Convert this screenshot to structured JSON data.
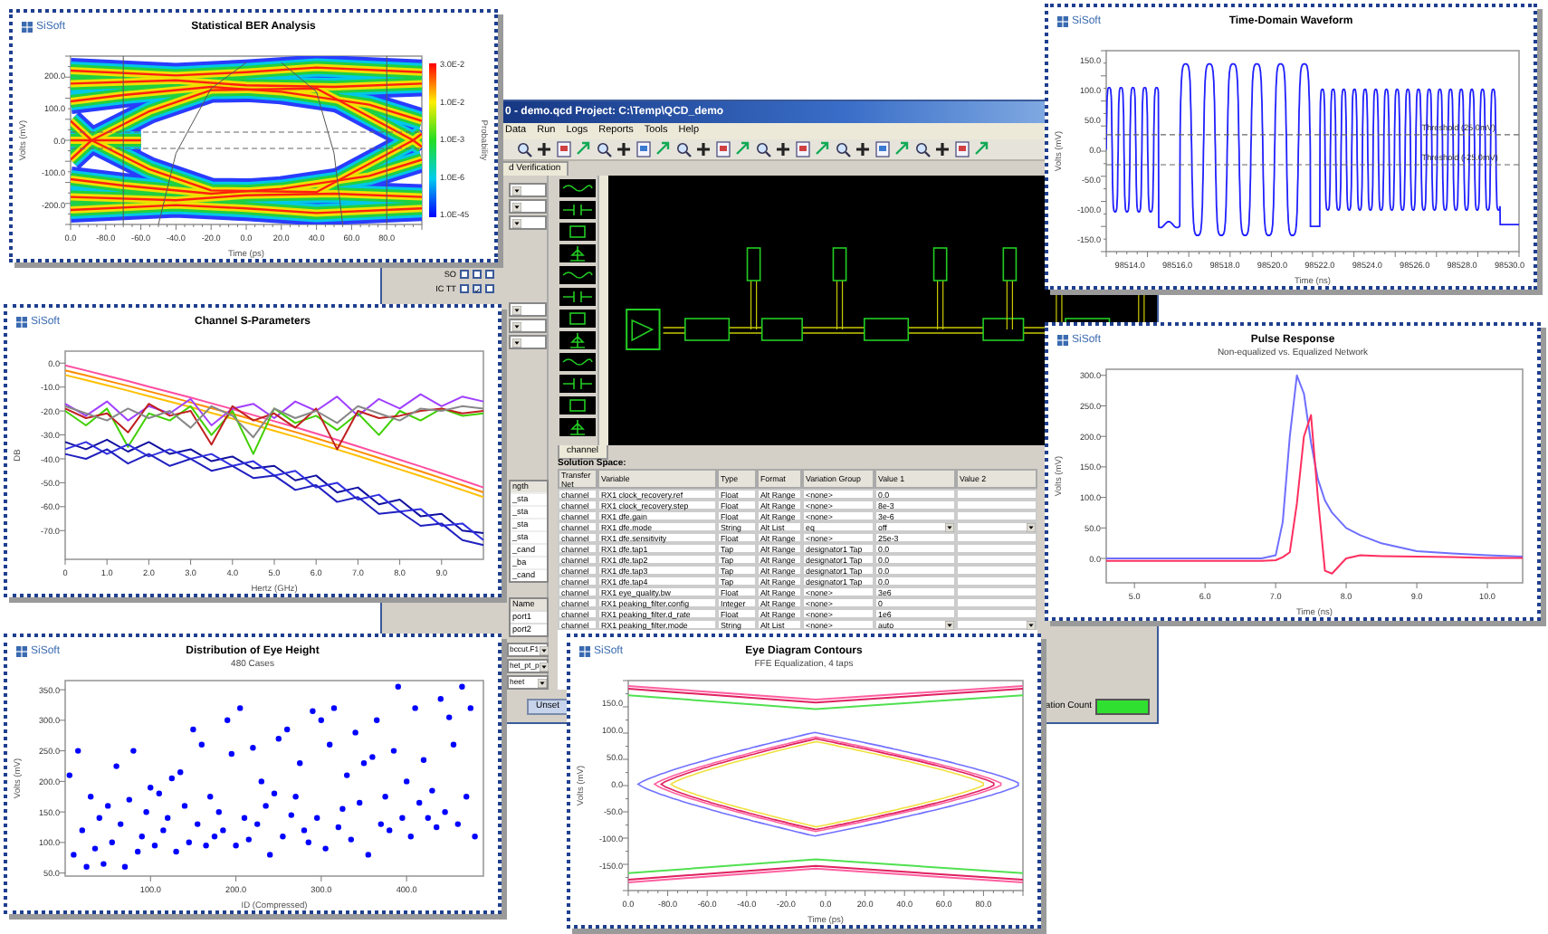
{
  "app_window": {
    "title": "0 - demo.qcd Project: C:\\Temp\\QCD_demo",
    "menu": [
      "Data",
      "Run",
      "Logs",
      "Reports",
      "Tools",
      "Help"
    ],
    "tab": "d Verification",
    "left_panel": {
      "checkbox_rows": [
        {
          "label": "SO",
          "checks": [
            {
              "checked": false
            },
            {
              "checked": false
            },
            {
              "checked": false
            }
          ]
        },
        {
          "label": "IC TT",
          "checks": [
            {
              "checked": false
            },
            {
              "checked": true
            },
            {
              "checked": false
            }
          ]
        }
      ],
      "list": {
        "header": "ngth",
        "items": [
          "_sta",
          "_sta",
          "_sta",
          "_sta",
          "_cand",
          "_ba",
          "_cand"
        ]
      },
      "name_table": {
        "header": "Name",
        "rows": [
          "port1",
          "port2"
        ]
      },
      "dropdowns": [
        "bccut.F1",
        "het_pt_p",
        "heet"
      ]
    },
    "schematic": {
      "tab": "channel"
    },
    "solution_space": {
      "title": "Solution Space:",
      "columns": [
        "Transfer Net",
        "Variable",
        "Type",
        "Format",
        "Variation Group",
        "Value 1",
        "Value 2"
      ],
      "rows": [
        {
          "transfer_net": "channel",
          "variable": "RX1 clock_recovery.ref",
          "type": "Float",
          "format": "Alt Range",
          "variation_group": "<none>",
          "value_1": "0.0",
          "value_1_dropdown": false,
          "value_2_dropdown": false
        },
        {
          "transfer_net": "channel",
          "variable": "RX1 clock_recovery.step",
          "type": "Float",
          "format": "Alt Range",
          "variation_group": "<none>",
          "value_1": "8e-3",
          "value_1_dropdown": false,
          "value_2_dropdown": false
        },
        {
          "transfer_net": "channel",
          "variable": "RX1 dfe.gain",
          "type": "Float",
          "format": "Alt Range",
          "variation_group": "<none>",
          "value_1": "3e-6",
          "value_1_dropdown": false,
          "value_2_dropdown": false
        },
        {
          "transfer_net": "channel",
          "variable": "RX1 dfe.mode",
          "type": "String",
          "format": "Alt List",
          "variation_group": "eq",
          "value_1": "off",
          "value_1_dropdown": true,
          "value_2_dropdown": true
        },
        {
          "transfer_net": "channel",
          "variable": "RX1 dfe.sensitivity",
          "type": "Float",
          "format": "Alt Range",
          "variation_group": "<none>",
          "value_1": "25e-3",
          "value_1_dropdown": false,
          "value_2_dropdown": false
        },
        {
          "transfer_net": "channel",
          "variable": "RX1 dfe.tap1",
          "type": "Tap",
          "format": "Alt Range",
          "variation_group": "designator1 Tap",
          "value_1": "0.0",
          "value_1_dropdown": false,
          "value_2_dropdown": false
        },
        {
          "transfer_net": "channel",
          "variable": "RX1 dfe.tap2",
          "type": "Tap",
          "format": "Alt Range",
          "variation_group": "designator1 Tap",
          "value_1": "0.0",
          "value_1_dropdown": false,
          "value_2_dropdown": false
        },
        {
          "transfer_net": "channel",
          "variable": "RX1 dfe.tap3",
          "type": "Tap",
          "format": "Alt Range",
          "variation_group": "designator1 Tap",
          "value_1": "0.0",
          "value_1_dropdown": false,
          "value_2_dropdown": false
        },
        {
          "transfer_net": "channel",
          "variable": "RX1 dfe.tap4",
          "type": "Tap",
          "format": "Alt Range",
          "variation_group": "designator1 Tap",
          "value_1": "0.0",
          "value_1_dropdown": false,
          "value_2_dropdown": false
        },
        {
          "transfer_net": "channel",
          "variable": "RX1 eye_quality.bw",
          "type": "Float",
          "format": "Alt Range",
          "variation_group": "<none>",
          "value_1": "3e6",
          "value_1_dropdown": false,
          "value_2_dropdown": false
        },
        {
          "transfer_net": "channel",
          "variable": "RX1 peaking_filter.config",
          "type": "Integer",
          "format": "Alt Range",
          "variation_group": "<none>",
          "value_1": "0",
          "value_1_dropdown": false,
          "value_2_dropdown": false
        },
        {
          "transfer_net": "channel",
          "variable": "RX1 peaking_filter.d_rate",
          "type": "Float",
          "format": "Alt Range",
          "variation_group": "<none>",
          "value_1": "1e6",
          "value_1_dropdown": false,
          "value_2_dropdown": false
        },
        {
          "transfer_net": "channel",
          "variable": "RX1 peaking_filter.mode",
          "type": "String",
          "format": "Alt List",
          "variation_group": "<none>",
          "value_1": "auto",
          "value_1_dropdown": true,
          "value_2_dropdown": true
        }
      ]
    },
    "unset_button": "Unset",
    "count_label": "ation Count"
  },
  "plot_windows": [
    {
      "kind": "ber",
      "logo": "SiSoft",
      "title": "Statistical BER Analysis",
      "xlabel": "Time (ps)",
      "ylabel": "Volts (mV)",
      "x_axis_labels": [
        "0.0",
        "-80.0",
        "-60.0",
        "-40.0",
        "-20.0",
        "0.0",
        "20.0",
        "40.0",
        "60.0",
        "80.0"
      ],
      "y_axis_labels": [
        "200.0",
        "100.0",
        "0.0",
        "-100.0",
        "-200.0"
      ],
      "colorbar_labels": [
        "3.0E-2",
        "1.0E-2",
        "1.0E-3",
        "1.0E-6",
        "1.0E-45"
      ],
      "colorbar_title": "Probability"
    },
    {
      "kind": "waveform",
      "logo": "SiSoft",
      "title": "Time-Domain Waveform",
      "xlabel": "Time (ns)",
      "ylabel": "Volts (mV)",
      "x_axis_labels": [
        "98514.0",
        "98516.0",
        "98518.0",
        "98520.0",
        "98522.0",
        "98524.0",
        "98526.0",
        "98528.0",
        "98530.0"
      ],
      "y_axis_labels": [
        "150.0",
        "100.0",
        "50.0",
        "0.0",
        "-50.0",
        "-100.0",
        "-150.0"
      ],
      "annotations": [
        "Threshold (25.0mV)",
        "Threshold (-25.0mV)"
      ]
    },
    {
      "kind": "chart",
      "logo": "SiSoft",
      "title": "Channel S-Parameters",
      "chart_data": {
        "type": "line",
        "xlabel": "Hertz (GHz)",
        "ylabel": "DB",
        "x": [
          0,
          0.5,
          1,
          1.5,
          2,
          2.5,
          3,
          3.5,
          4,
          4.5,
          5,
          5.5,
          6,
          6.5,
          7,
          7.5,
          8,
          8.5,
          9,
          9.5,
          10
        ],
        "series": [
          {
            "color": "#ff4fa0",
            "values": [
              -1,
              -3.1,
              -5.3,
              -7.5,
              -9.8,
              -12.1,
              -14.4,
              -16.8,
              -19.2,
              -21.7,
              -24.3,
              -26.8,
              -29.4,
              -32.1,
              -34.8,
              -37.6,
              -40.4,
              -43.2,
              -46.1,
              -49.0,
              -52.0
            ]
          },
          {
            "color": "#ff8c00",
            "values": [
              -3,
              -5.1,
              -7.3,
              -9.5,
              -11.8,
              -14.1,
              -16.4,
              -18.8,
              -21.2,
              -23.7,
              -26.3,
              -28.8,
              -31.4,
              -34.1,
              -36.8,
              -39.6,
              -42.4,
              -45.2,
              -48.1,
              -51.0,
              -54.0
            ]
          },
          {
            "color": "#ffc000",
            "values": [
              -5,
              -7.1,
              -9.3,
              -11.5,
              -13.8,
              -16.1,
              -18.4,
              -20.8,
              -23.2,
              -25.7,
              -28.3,
              -30.8,
              -33.4,
              -36.1,
              -38.8,
              -41.6,
              -44.4,
              -47.2,
              -50.1,
              -53.0,
              -56.0
            ]
          },
          {
            "color": "#a040ff",
            "values": [
              -17,
              -22,
              -16,
              -24,
              -18,
              -21,
              -15,
              -26,
              -19,
              -17,
              -23,
              -16,
              -20,
              -14,
              -22,
              -15,
              -19,
              -13,
              -18,
              -14,
              -16
            ]
          },
          {
            "color": "#40d000",
            "values": [
              -20,
              -26,
              -19,
              -35,
              -21,
              -24,
              -18,
              -30,
              -20,
              -38,
              -19,
              -25,
              -22,
              -28,
              -21,
              -30,
              -20,
              -24,
              -19,
              -22,
              -21
            ]
          },
          {
            "color": "#c02020",
            "values": [
              -19,
              -23,
              -21,
              -29,
              -17,
              -22,
              -20,
              -34,
              -18,
              -24,
              -21,
              -27,
              -19,
              -36,
              -20,
              -23,
              -22,
              -20,
              -19,
              -21,
              -20
            ]
          },
          {
            "color": "#888888",
            "values": [
              -18,
              -21,
              -24,
              -19,
              -23,
              -20,
              -27,
              -18,
              -22,
              -31,
              -19,
              -23,
              -20,
              -25,
              -18,
              -21,
              -24,
              -19,
              -20,
              -18,
              -19
            ]
          },
          {
            "color": "#1010a0",
            "values": [
              -33,
              -36,
              -32,
              -37,
              -33,
              -38,
              -36,
              -41,
              -39,
              -44,
              -43,
              -49,
              -47,
              -54,
              -52,
              -59,
              -57,
              -64,
              -63,
              -70,
              -71
            ]
          },
          {
            "color": "#3030e0",
            "values": [
              -36,
              -33,
              -38,
              -34,
              -39,
              -36,
              -40,
              -38,
              -43,
              -41,
              -47,
              -45,
              -52,
              -50,
              -57,
              -55,
              -62,
              -61,
              -68,
              -67,
              -74
            ]
          },
          {
            "color": "#2020c0",
            "values": [
              -38,
              -40,
              -36,
              -42,
              -38,
              -43,
              -40,
              -45,
              -43,
              -48,
              -47,
              -53,
              -51,
              -58,
              -56,
              -63,
              -62,
              -68,
              -67,
              -74,
              -76
            ]
          }
        ],
        "xlim": [
          0,
          10
        ],
        "ylim": [
          -82,
          5
        ],
        "xticks": [
          {
            "value": 0,
            "label": "0"
          },
          {
            "value": 1,
            "label": "1.0"
          },
          {
            "value": 2,
            "label": "2.0"
          },
          {
            "value": 3,
            "label": "3.0"
          },
          {
            "value": 4,
            "label": "4.0"
          },
          {
            "value": 5,
            "label": "5.0"
          },
          {
            "value": 6,
            "label": "6.0"
          },
          {
            "value": 7,
            "label": "7.0"
          },
          {
            "value": 8,
            "label": "8.0"
          },
          {
            "value": 9,
            "label": "9.0"
          }
        ],
        "yticks": [
          {
            "value": 0,
            "label": "0.0"
          },
          {
            "value": -10,
            "label": "-10.0"
          },
          {
            "value": -20,
            "label": "-20.0"
          },
          {
            "value": -30,
            "label": "-30.0"
          },
          {
            "value": -40,
            "label": "-40.0"
          },
          {
            "value": -50,
            "label": "-50.0"
          },
          {
            "value": -60,
            "label": "-60.0"
          },
          {
            "value": -70,
            "label": "-70.0"
          }
        ]
      }
    },
    {
      "kind": "chart",
      "logo": "SiSoft",
      "title": "Pulse Response",
      "subtitle": "Non-equalized vs. Equalized Network",
      "chart_data": {
        "type": "line",
        "xlabel": "Time (ns)",
        "ylabel": "Volts (mV)",
        "x": [
          4.6,
          5.0,
          6.0,
          6.8,
          7.0,
          7.1,
          7.2,
          7.3,
          7.4,
          7.5,
          7.6,
          7.7,
          7.8,
          8.0,
          8.2,
          8.5,
          9.0,
          9.5,
          10.0,
          10.5
        ],
        "series": [
          {
            "color": "#6f6fff",
            "values": [
              0,
              0,
              0,
              0,
              5,
              60,
              200,
              300,
              270,
              190,
              130,
              95,
              75,
              50,
              38,
              25,
              12,
              8,
              5,
              3
            ]
          },
          {
            "color": "#ff2f5f",
            "values": [
              -4,
              -4,
              -4,
              -4,
              -3,
              2,
              10,
              90,
              200,
              235,
              100,
              -20,
              -25,
              0,
              5,
              4,
              3,
              2,
              1,
              1
            ]
          }
        ],
        "xlim": [
          4.6,
          10.5
        ],
        "ylim": [
          -40,
          310
        ],
        "xticks": [
          {
            "value": 5,
            "label": "5.0"
          },
          {
            "value": 6,
            "label": "6.0"
          },
          {
            "value": 7,
            "label": "7.0"
          },
          {
            "value": 8,
            "label": "8.0"
          },
          {
            "value": 9,
            "label": "9.0"
          },
          {
            "value": 10,
            "label": "10.0"
          }
        ],
        "yticks": [
          {
            "value": 0,
            "label": "0.0"
          },
          {
            "value": 50,
            "label": "50.0"
          },
          {
            "value": 100,
            "label": "100.0"
          },
          {
            "value": 150,
            "label": "150.0"
          },
          {
            "value": 200,
            "label": "200.0"
          },
          {
            "value": 250,
            "label": "250.0"
          },
          {
            "value": 300,
            "label": "300.0"
          }
        ]
      }
    },
    {
      "kind": "chart",
      "logo": "SiSoft",
      "title": "Distribution of Eye Height",
      "subtitle": "480 Cases",
      "chart_data": {
        "type": "scatter",
        "xlabel": "ID (Compressed)",
        "ylabel": "Volts (mV)",
        "x": [
          5,
          10,
          15,
          20,
          25,
          30,
          35,
          40,
          45,
          50,
          55,
          60,
          65,
          70,
          75,
          80,
          85,
          90,
          95,
          100,
          105,
          110,
          115,
          120,
          125,
          130,
          135,
          140,
          145,
          150,
          155,
          160,
          165,
          170,
          175,
          180,
          185,
          190,
          195,
          200,
          205,
          210,
          215,
          220,
          225,
          230,
          235,
          240,
          245,
          250,
          255,
          260,
          265,
          270,
          275,
          280,
          285,
          290,
          295,
          300,
          305,
          310,
          315,
          320,
          325,
          330,
          335,
          340,
          345,
          350,
          355,
          360,
          365,
          370,
          375,
          380,
          385,
          390,
          395,
          400,
          405,
          410,
          415,
          420,
          425,
          430,
          435,
          440,
          445,
          450,
          455,
          460,
          465,
          470,
          475,
          480
        ],
        "series": [
          {
            "color": "#0000ff",
            "values": [
              210,
              80,
              250,
              120,
              60,
              175,
              90,
              140,
              65,
              160,
              100,
              225,
              130,
              60,
              170,
              250,
              85,
              110,
              150,
              190,
              95,
              180,
              120,
              140,
              205,
              85,
              215,
              160,
              100,
              285,
              130,
              260,
              95,
              175,
              110,
              150,
              120,
              300,
              245,
              95,
              320,
              140,
              105,
              255,
              130,
              200,
              160,
              80,
              180,
              270,
              110,
              285,
              145,
              175,
              230,
              120,
              100,
              315,
              140,
              300,
              90,
              260,
              320,
              125,
              155,
              210,
              105,
              280,
              165,
              230,
              80,
              240,
              300,
              130,
              175,
              120,
              250,
              355,
              140,
              200,
              110,
              320,
              165,
              235,
              140,
              185,
              125,
              335,
              150,
              305,
              260,
              130,
              355,
              175,
              320,
              110
            ]
          }
        ],
        "xlim": [
          0,
          490
        ],
        "ylim": [
          45,
          365
        ],
        "xticks": [
          {
            "value": 100,
            "label": "100.0"
          },
          {
            "value": 200,
            "label": "200.0"
          },
          {
            "value": 300,
            "label": "300.0"
          },
          {
            "value": 400,
            "label": "400.0"
          }
        ],
        "yticks": [
          {
            "value": 50,
            "label": "50.0"
          },
          {
            "value": 100,
            "label": "100.0"
          },
          {
            "value": 150,
            "label": "150.0"
          },
          {
            "value": 200,
            "label": "200.0"
          },
          {
            "value": 250,
            "label": "250.0"
          },
          {
            "value": 300,
            "label": "300.0"
          },
          {
            "value": 350,
            "label": "350.0"
          }
        ]
      }
    },
    {
      "kind": "eye",
      "logo": "SiSoft",
      "title": "Eye Diagram Contours",
      "subtitle": "FFE Equalization, 4 taps",
      "xlabel": "Time (ps)",
      "ylabel": "Volts (mV)",
      "x_axis_labels": [
        "0.0",
        "-80.0",
        "-60.0",
        "-40.0",
        "-20.0",
        "0.0",
        "20.0",
        "40.0",
        "60.0",
        "80.0"
      ],
      "y_axis_labels": [
        "150.0",
        "100.0",
        "50.0",
        "0.0",
        "-50.0",
        "-100.0",
        "-150.0"
      ]
    }
  ]
}
